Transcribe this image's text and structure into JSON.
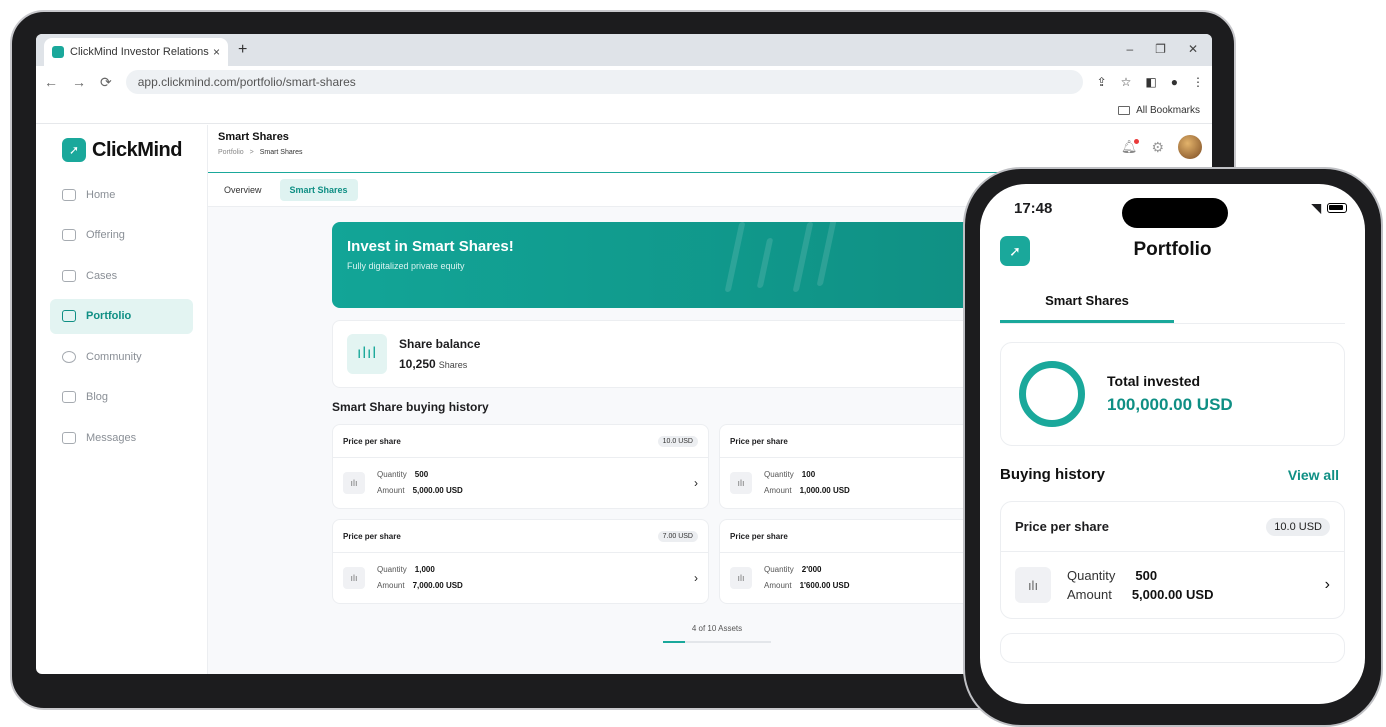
{
  "browser": {
    "tab_title": "ClickMind Investor Relations",
    "tab_close": "×",
    "new_tab": "+",
    "url": "app.clickmind.com/portfolio/smart-shares",
    "bookmarks_label": "All Bookmarks"
  },
  "sidebar": {
    "logo_text": "ClickMind",
    "items": [
      {
        "label": "Home"
      },
      {
        "label": "Offering"
      },
      {
        "label": "Cases"
      },
      {
        "label": "Portfolio"
      },
      {
        "label": "Community"
      },
      {
        "label": "Blog"
      },
      {
        "label": "Messages"
      }
    ]
  },
  "header": {
    "title": "Smart Shares",
    "breadcrumb_root": "Portfolio",
    "breadcrumb_sep": ">",
    "breadcrumb_current": "Smart Shares"
  },
  "subtabs": [
    "Overview",
    "Smart Shares"
  ],
  "banner": {
    "title": "Invest in Smart Shares!",
    "subtitle": "Fully digitalized private equity"
  },
  "balance": {
    "title": "Share balance",
    "value": "10,250",
    "unit": "Shares"
  },
  "history": {
    "title": "Smart Share buying history",
    "card_header": "Price per share",
    "quantity_label": "Quantity",
    "amount_label": "Amount",
    "cards": [
      {
        "price": "10.0 USD",
        "quantity": "500",
        "amount": "5,000.00 USD"
      },
      {
        "price": "",
        "quantity": "100",
        "amount": "1,000.00 USD"
      },
      {
        "price": "7.00 USD",
        "quantity": "1,000",
        "amount": "7,000.00 USD"
      },
      {
        "price": "",
        "quantity": "2'000",
        "amount": "1'600.00 USD"
      }
    ],
    "pager_text": "4 of 10 Assets",
    "pager_fraction": 0.2
  },
  "phone": {
    "time": "17:48",
    "title": "Portfolio",
    "tab": "Smart Shares",
    "total_label": "Total invested",
    "total_value": "100,000.00 USD",
    "history_title": "Buying history",
    "view_all": "View all",
    "card": {
      "header": "Price per share",
      "price": "10.0 USD",
      "quantity_label": "Quantity",
      "quantity": "500",
      "amount_label": "Amount",
      "amount": "5,000.00 USD"
    }
  },
  "colors": {
    "accent": "#1aa89b",
    "accent_dark": "#0f8f84"
  }
}
